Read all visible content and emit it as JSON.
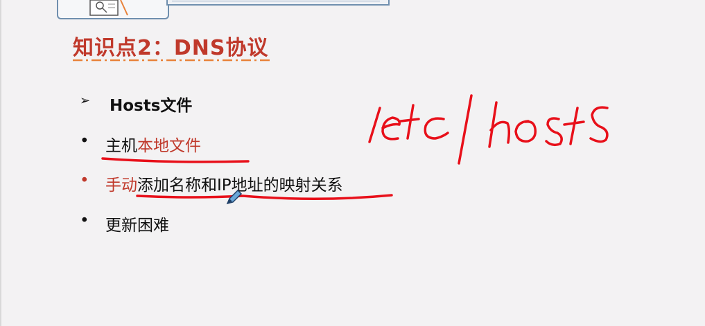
{
  "slide": {
    "title": "知识点2：DNS协议",
    "heading": {
      "marker": "➢",
      "text": "Hosts文件"
    },
    "bullets": [
      {
        "marker": "•",
        "parts": [
          {
            "text": "主机",
            "emphasis": false
          },
          {
            "text": "本地文件",
            "emphasis": true
          }
        ]
      },
      {
        "marker": "•",
        "parts": [
          {
            "text": "手动",
            "emphasis": true
          },
          {
            "text": "添加名称和IP地址的映射关系",
            "emphasis": false
          }
        ]
      },
      {
        "marker": "•",
        "parts": [
          {
            "text": "更新困难",
            "emphasis": false
          }
        ]
      }
    ],
    "handwriting": "/etc/hosts",
    "colors": {
      "accent": "#c0392b",
      "ink": "#e8101a",
      "rule": "#e8823a",
      "frame": "#6f8fae"
    }
  }
}
